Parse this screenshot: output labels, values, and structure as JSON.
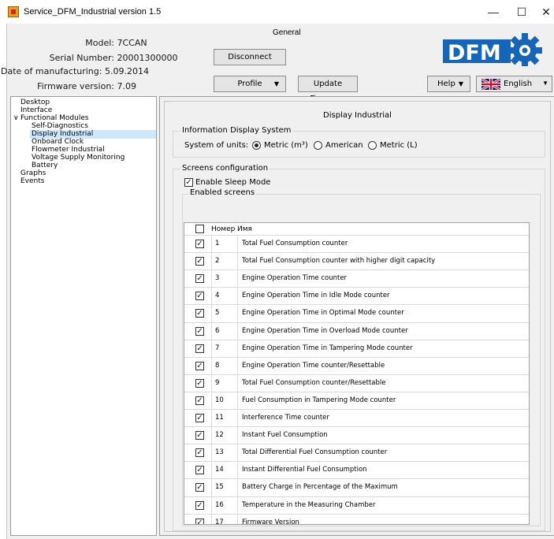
{
  "window": {
    "title": "Service_DFM_Industrial version 1.5",
    "controls": {
      "minimize": "—",
      "maximize": "☐",
      "close": "✕"
    }
  },
  "header": {
    "group_label": "General",
    "model_label": "Model:",
    "model_value": "7CCAN",
    "serial_label": "Serial Number:",
    "serial_value": "20001300000",
    "date_label": "Date of manufacturing:",
    "date_value": "5.09.2014",
    "firmware_label": "Firmware version:",
    "firmware_value": "7.09",
    "disconnect_label": "Disconnect",
    "profile_label": "Profile",
    "update_label": "Update Firmware",
    "help_label": "Help",
    "language_value": "English",
    "logo_text": "DFM"
  },
  "tree": {
    "items": [
      {
        "label": "Desktop"
      },
      {
        "label": "Interface"
      },
      {
        "label": "Functional Modules"
      },
      {
        "label": "Self-Diagnostics"
      },
      {
        "label": "Display Industrial"
      },
      {
        "label": "Onboard Clock"
      },
      {
        "label": "Flowmeter Industrial"
      },
      {
        "label": "Voltage Supply Monitoring"
      },
      {
        "label": "Battery"
      },
      {
        "label": "Graphs"
      },
      {
        "label": "Events"
      }
    ],
    "expander": "∨"
  },
  "panel": {
    "title": "Display Industrial",
    "info_group": "Information Display System",
    "units_label": "System of units:",
    "units": [
      {
        "label": "Metric (m³)",
        "selected": true
      },
      {
        "label": "American",
        "selected": false
      },
      {
        "label": "Metric (L)",
        "selected": false
      }
    ],
    "screens_group": "Screens configuration",
    "sleep_label": "Enable Sleep Mode",
    "enabled_group": "Enabled screens",
    "col_number": "Номер",
    "col_name": "Имя",
    "check_mark": "✓"
  },
  "screens": [
    {
      "num": "1",
      "name": "Total Fuel Consumption counter"
    },
    {
      "num": "2",
      "name": "Total Fuel Consumption counter with higher digit capacity"
    },
    {
      "num": "3",
      "name": "Engine Operation Time counter"
    },
    {
      "num": "4",
      "name": "Engine Operation Time in Idle Mode counter"
    },
    {
      "num": "5",
      "name": "Engine Operation Time in Optimal Mode counter"
    },
    {
      "num": "6",
      "name": "Engine Operation Time in Overload Mode counter"
    },
    {
      "num": "7",
      "name": "Engine Operation Time in Tampering Mode counter"
    },
    {
      "num": "8",
      "name": "Engine Operation Time counter/Resettable"
    },
    {
      "num": "9",
      "name": "Total Fuel Consumption counter/Resettable"
    },
    {
      "num": "10",
      "name": "Fuel Consumption in Tampering Mode counter"
    },
    {
      "num": "11",
      "name": "Interference Time counter"
    },
    {
      "num": "12",
      "name": "Instant Fuel Consumption"
    },
    {
      "num": "13",
      "name": "Total Differential Fuel Consumption counter"
    },
    {
      "num": "14",
      "name": "Instant Differential Fuel Consumption"
    },
    {
      "num": "15",
      "name": "Battery Charge in Percentage of the Maximum"
    },
    {
      "num": "16",
      "name": "Temperature in the Measuring Chamber"
    },
    {
      "num": "17",
      "name": "Firmware Version"
    }
  ],
  "colors": {
    "logo_blue": "#1565b8",
    "selection": "#cce8ff"
  }
}
